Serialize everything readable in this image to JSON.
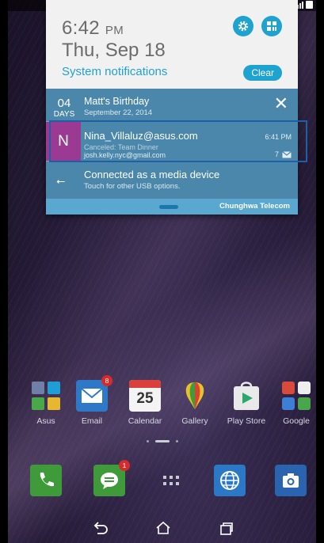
{
  "shade": {
    "time": "6:42",
    "ampm": "PM",
    "date": "Thu, Sep 18",
    "system_notifications": "System notifications",
    "clear": "Clear"
  },
  "notifications": {
    "birthday": {
      "day_number": "04",
      "day_unit": "DAYS",
      "title": "Matt's Birthday",
      "subtitle": "September 22, 2014"
    },
    "email": {
      "avatar_letter": "N",
      "from": "Nina_Villaluz@asus.com",
      "subject": "Canceled: Team Dinner",
      "account": "josh.kelly.nyc@gmail.com",
      "time": "6:41 PM",
      "count": "7"
    },
    "usb": {
      "title": "Connected as a media device",
      "subtitle": "Touch for other USB options."
    }
  },
  "carrier": "Chunghwa Telecom",
  "apps": [
    {
      "label": "Asus",
      "icon": "asus-folder-icon"
    },
    {
      "label": "Email",
      "icon": "email-icon",
      "badge": "8"
    },
    {
      "label": "Calendar",
      "icon": "calendar-icon",
      "date": "25"
    },
    {
      "label": "Gallery",
      "icon": "gallery-icon"
    },
    {
      "label": "Play Store",
      "icon": "play-store-icon"
    },
    {
      "label": "Google",
      "icon": "google-folder-icon"
    }
  ],
  "dock": [
    {
      "icon": "phone-icon"
    },
    {
      "icon": "messaging-icon",
      "badge": "1"
    },
    {
      "icon": "all-apps-icon"
    },
    {
      "icon": "browser-icon"
    },
    {
      "icon": "camera-icon"
    }
  ],
  "colors": {
    "accent": "#1ea2cf",
    "notification": "#4a87ab",
    "avatar": "#9a3a92",
    "highlight": "#1f5fa8"
  }
}
